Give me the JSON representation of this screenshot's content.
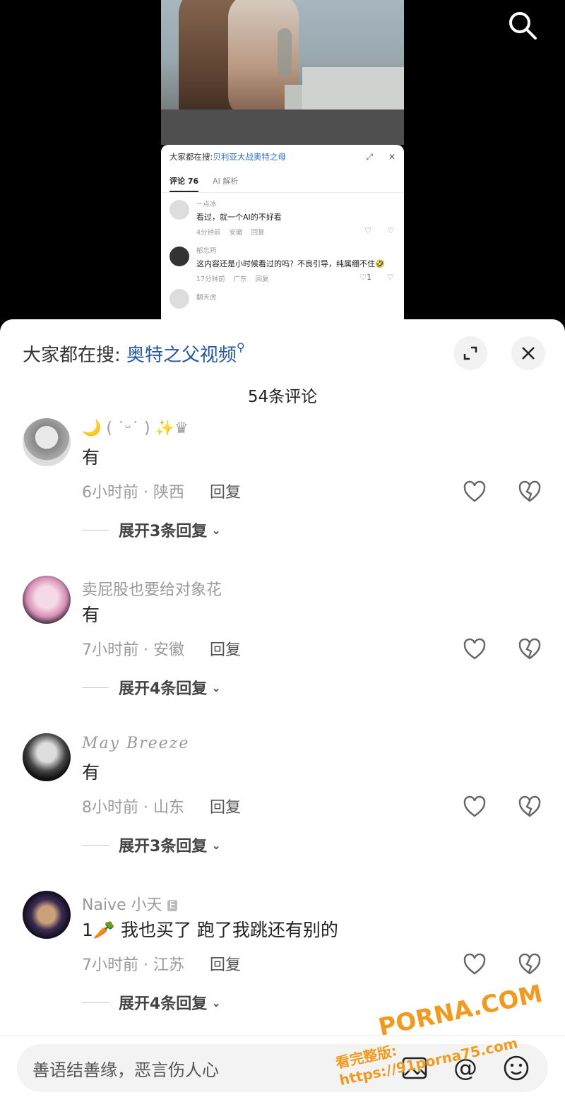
{
  "video_panel": {
    "mini_sheet": {
      "hot_search_prefix": "大家都在搜:",
      "hot_search_query": "贝利亚大战奥特之母",
      "tabs": [
        "评论 76",
        "AI 解析"
      ],
      "comments": [
        {
          "name": "一点冰",
          "text": "看过，就一个AI的不好看",
          "time": "4分钟前",
          "location": "安徽",
          "reply": "回复",
          "likes": ""
        },
        {
          "name": "郁忘筠",
          "text": "这内容还是小时候看过的吗？不良引导，纯属绷不住🤣",
          "time": "17分钟前",
          "location": "广东",
          "reply": "回复",
          "likes": "1"
        },
        {
          "name": "翻天虎",
          "text": "",
          "time": "",
          "location": "",
          "reply": "",
          "likes": ""
        }
      ]
    }
  },
  "sheet": {
    "hot_search_prefix": "大家都在搜:",
    "hot_search_query": "奥特之父视频",
    "comment_count": "54条评论",
    "comments": [
      {
        "name": "🌙 ( ˙ᵕ˙ ) ✨♛",
        "text": "有",
        "meta": "6小时前 · 陕西",
        "reply": "回复",
        "expand": "展开3条回复"
      },
      {
        "name": "卖屁股也要给对象花",
        "text": "有",
        "meta": "7小时前 · 安徽",
        "reply": "回复",
        "expand": "展开4条回复"
      },
      {
        "name": "May Breeze",
        "text": "有",
        "meta": "8小时前 · 山东",
        "reply": "回复",
        "expand": "展开3条回复"
      },
      {
        "name": "Naive 小天",
        "text": "1🥕 我也买了 跑了我跳还有别的",
        "meta": "7小时前 · 江苏",
        "reply": "回复",
        "expand": "展开4条回复"
      }
    ]
  },
  "input": {
    "placeholder": "善语结善缘，恶言伤人心"
  },
  "watermark": {
    "brand": "PORNA.COM",
    "url": "看完整版: https://91porna75.com"
  },
  "colors": {
    "link": "#2156a9",
    "accent": "#f39a1e"
  }
}
